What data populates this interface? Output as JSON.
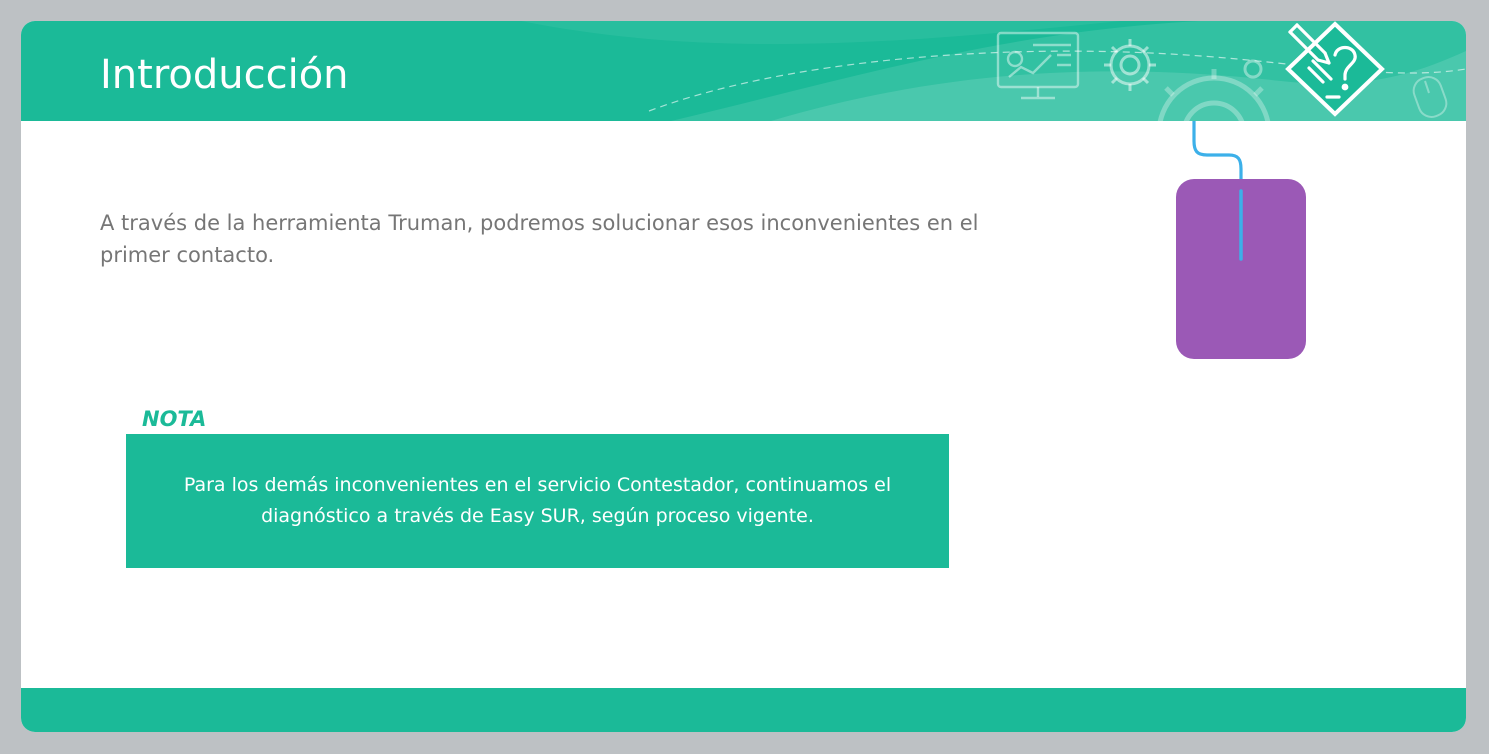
{
  "slide": {
    "title": "Introducción",
    "intro_text": "A través de la herramienta Truman, podremos solucionar esos inconvenientes en el primer contacto.",
    "note": {
      "label": "NOTA",
      "text": "Para los demás inconvenientes en el servicio Contestador, continuamos el diagnóstico a través de Easy SUR, según proceso vigente."
    }
  },
  "icons": {
    "header_decoration": [
      "monitor-chart-icon",
      "gear-icon",
      "large-gear-icon",
      "small-mouse-icon"
    ],
    "badge": "document-question-icon",
    "illustration": "computer-mouse-icon"
  },
  "colors": {
    "accent": "#1bba98",
    "background": "#bdc1c4",
    "body_text": "#767676",
    "mouse_body": "#9b59b6",
    "mouse_cable": "#3cb0e9"
  }
}
